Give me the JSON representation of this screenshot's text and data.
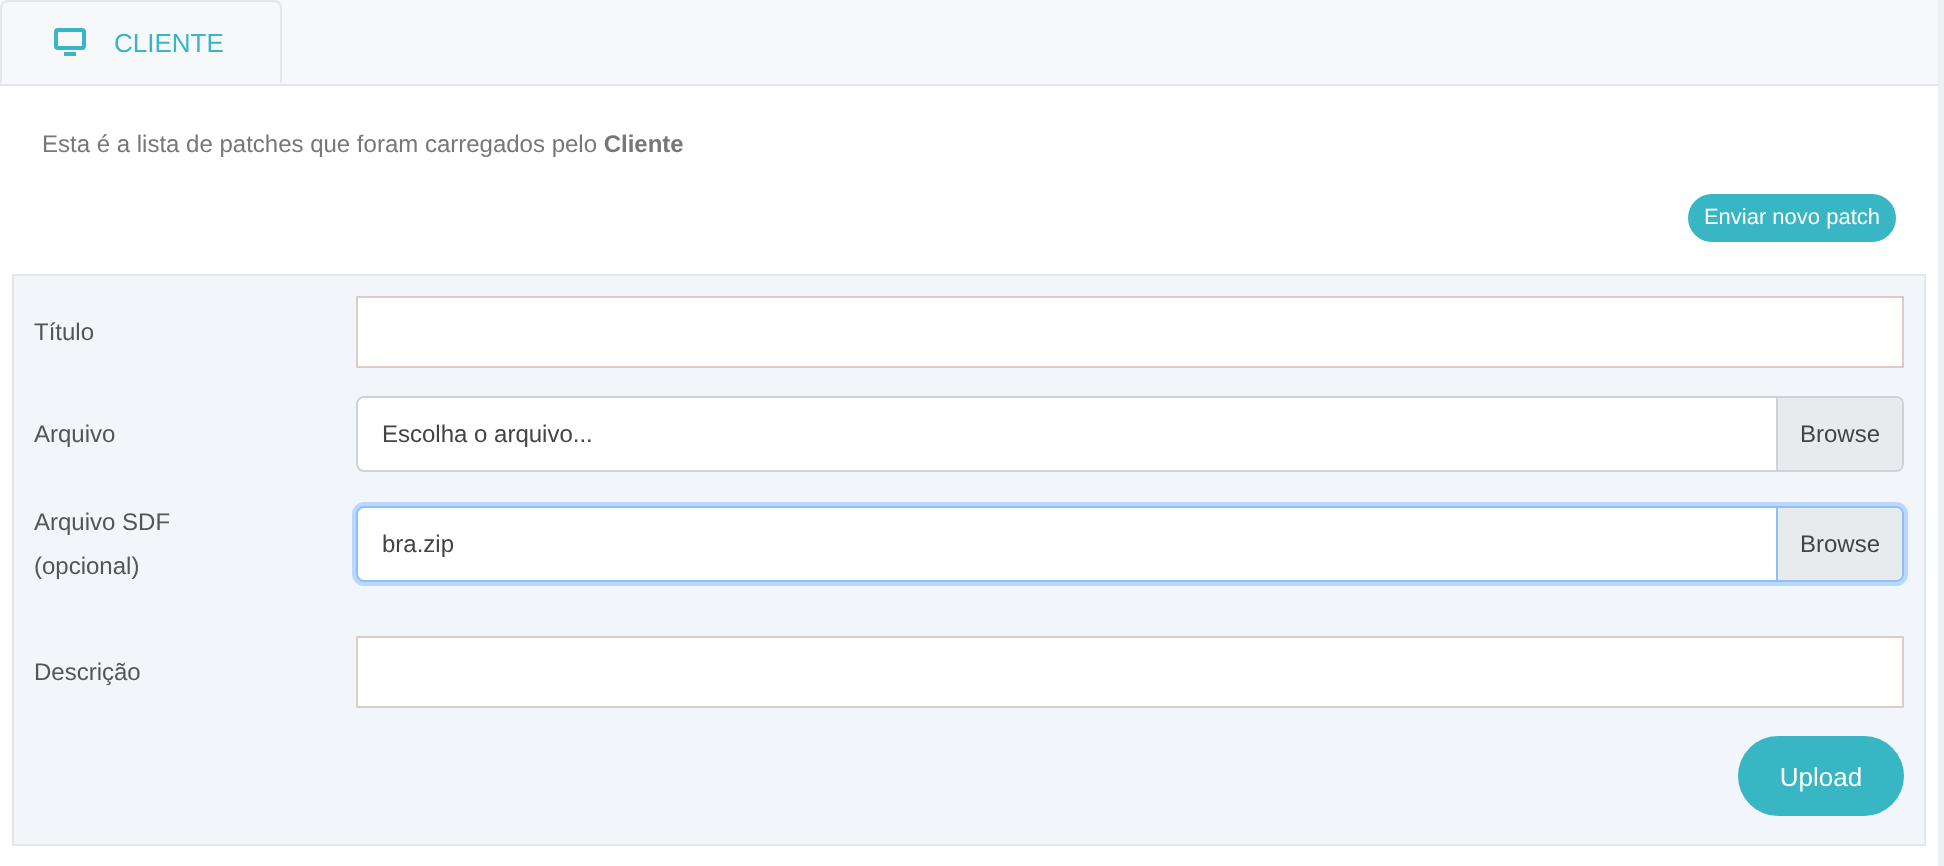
{
  "tabs": [
    {
      "label": "CLIENTE",
      "selected": true
    }
  ],
  "intro": "Esta é a lista de patches que foram carregados pelo **Cliente**",
  "new_button": "Enviar novo patch",
  "form": {
    "fields": [
      {
        "kind": "text",
        "label": "Título",
        "focused": false
      },
      {
        "kind": "file",
        "label": "Arquivo",
        "placeholder": "Escolha o arquivo...",
        "button": "Browse",
        "focused": false
      },
      {
        "kind": "file",
        "label": "Arquivo SDF (opcional)",
        "value": "bra.zip",
        "button": "Browse",
        "focused": true
      },
      {
        "kind": "text",
        "label": "Descrição",
        "focused": false
      }
    ],
    "submit": "Upload"
  }
}
